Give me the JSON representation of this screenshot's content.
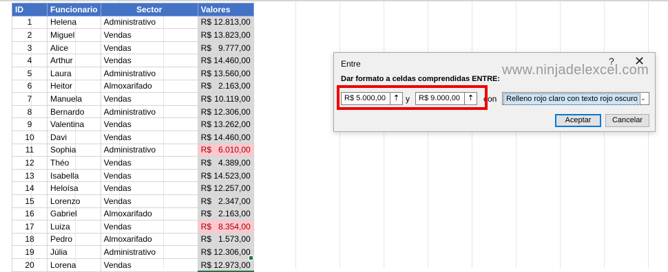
{
  "sheet": {
    "headers": {
      "id": "ID",
      "name": "Funcionario",
      "sector": "Sector",
      "value": "Valores"
    },
    "rows": [
      {
        "id": "1",
        "name": "Helena",
        "sector": "Administrativo",
        "cur": "R$",
        "num": "12.813,00",
        "hl": false
      },
      {
        "id": "2",
        "name": "Miguel",
        "sector": "Vendas",
        "cur": "R$",
        "num": "13.823,00",
        "hl": false
      },
      {
        "id": "3",
        "name": "Alice",
        "sector": "Vendas",
        "cur": "R$",
        "num": "9.777,00",
        "hl": false
      },
      {
        "id": "4",
        "name": "Arthur",
        "sector": "Vendas",
        "cur": "R$",
        "num": "14.460,00",
        "hl": false
      },
      {
        "id": "5",
        "name": "Laura",
        "sector": "Administrativo",
        "cur": "R$",
        "num": "13.560,00",
        "hl": false
      },
      {
        "id": "6",
        "name": "Heitor",
        "sector": "Almoxarifado",
        "cur": "R$",
        "num": "2.163,00",
        "hl": false
      },
      {
        "id": "7",
        "name": "Manuela",
        "sector": "Vendas",
        "cur": "R$",
        "num": "10.119,00",
        "hl": false
      },
      {
        "id": "8",
        "name": "Bernardo",
        "sector": "Administrativo",
        "cur": "R$",
        "num": "12.306,00",
        "hl": false
      },
      {
        "id": "9",
        "name": "Valentina",
        "sector": "Vendas",
        "cur": "R$",
        "num": "13.262,00",
        "hl": false
      },
      {
        "id": "10",
        "name": "Davi",
        "sector": "Vendas",
        "cur": "R$",
        "num": "14.460,00",
        "hl": false
      },
      {
        "id": "11",
        "name": "Sophia",
        "sector": "Administrativo",
        "cur": "R$",
        "num": "6.010,00",
        "hl": true
      },
      {
        "id": "12",
        "name": "Théo",
        "sector": "Vendas",
        "cur": "R$",
        "num": "4.389,00",
        "hl": false
      },
      {
        "id": "13",
        "name": "Isabella",
        "sector": "Vendas",
        "cur": "R$",
        "num": "14.523,00",
        "hl": false
      },
      {
        "id": "14",
        "name": "Heloísa",
        "sector": "Vendas",
        "cur": "R$",
        "num": "12.257,00",
        "hl": false
      },
      {
        "id": "15",
        "name": "Lorenzo",
        "sector": "Vendas",
        "cur": "R$",
        "num": "2.347,00",
        "hl": false
      },
      {
        "id": "16",
        "name": "Gabriel",
        "sector": "Almoxarifado",
        "cur": "R$",
        "num": "2.163,00",
        "hl": false
      },
      {
        "id": "17",
        "name": "Luiza",
        "sector": "Vendas",
        "cur": "R$",
        "num": "8.354,00",
        "hl": true
      },
      {
        "id": "18",
        "name": "Pedro",
        "sector": "Almoxarifado",
        "cur": "R$",
        "num": "1.573,00",
        "hl": false
      },
      {
        "id": "19",
        "name": "Júlia",
        "sector": "Administrativo",
        "cur": "R$",
        "num": "12.306,00",
        "hl": false
      },
      {
        "id": "20",
        "name": "Lorena",
        "sector": "Vendas",
        "cur": "R$",
        "num": "12.973,00",
        "hl": false
      }
    ]
  },
  "dialog": {
    "title": "Entre",
    "help_glyph": "?",
    "close_glyph": "✕",
    "watermark": "www.ninjadelexcel.com",
    "instruction": "Dar formato a celdas comprendidas ENTRE:",
    "min_value": "R$ 5.000,00",
    "max_value": "R$ 9.000,00",
    "y_label": "y",
    "con_label": "con",
    "format_option": "Relleno rojo claro con texto rojo oscuro",
    "ok_label": "Aceptar",
    "cancel_label": "Cancelar",
    "pick_icon": "range-picker-icon",
    "pick_glyph": "⇡"
  },
  "colors": {
    "header_bg": "#4472c4",
    "highlight_bg": "#ffc7ce",
    "highlight_text": "#9c0006",
    "selection_border": "#217346",
    "red_annotation": "#ee0000"
  }
}
